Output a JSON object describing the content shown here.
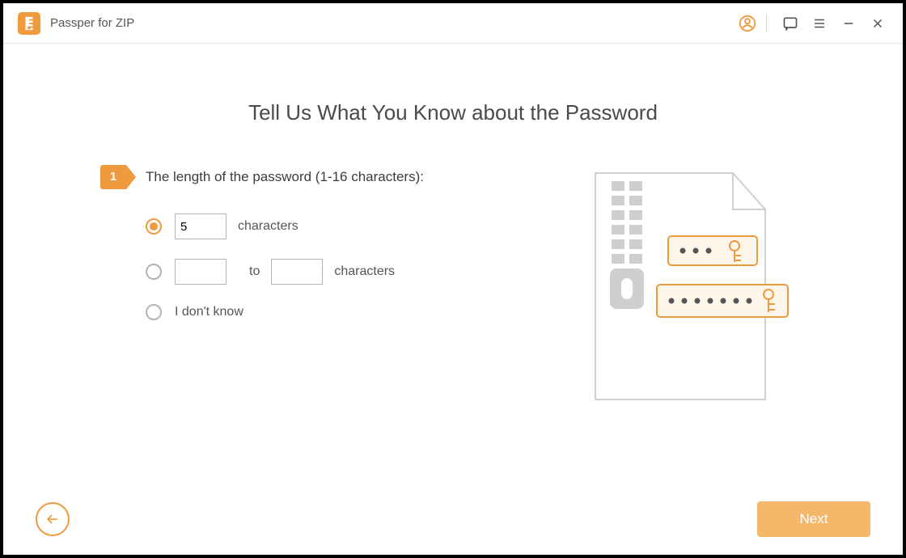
{
  "app": {
    "title": "Passper for ZIP"
  },
  "titlebar": {
    "icons": {
      "account": "account-icon",
      "feedback": "feedback-icon",
      "menu": "menu-icon",
      "minimize": "minimize-icon",
      "close": "close-icon"
    }
  },
  "heading": "Tell Us What You Know about the Password",
  "step": {
    "number": "1",
    "label": "The length of the password (1-16 characters):"
  },
  "options": {
    "exact": {
      "value": "5",
      "suffix": "characters",
      "selected": true
    },
    "range": {
      "from": "",
      "to_word": "to",
      "to": "",
      "suffix": "characters",
      "selected": false
    },
    "unknown": {
      "label": "I don't know",
      "selected": false
    }
  },
  "footer": {
    "next": "Next"
  },
  "colors": {
    "accent": "#ef9a3d"
  }
}
